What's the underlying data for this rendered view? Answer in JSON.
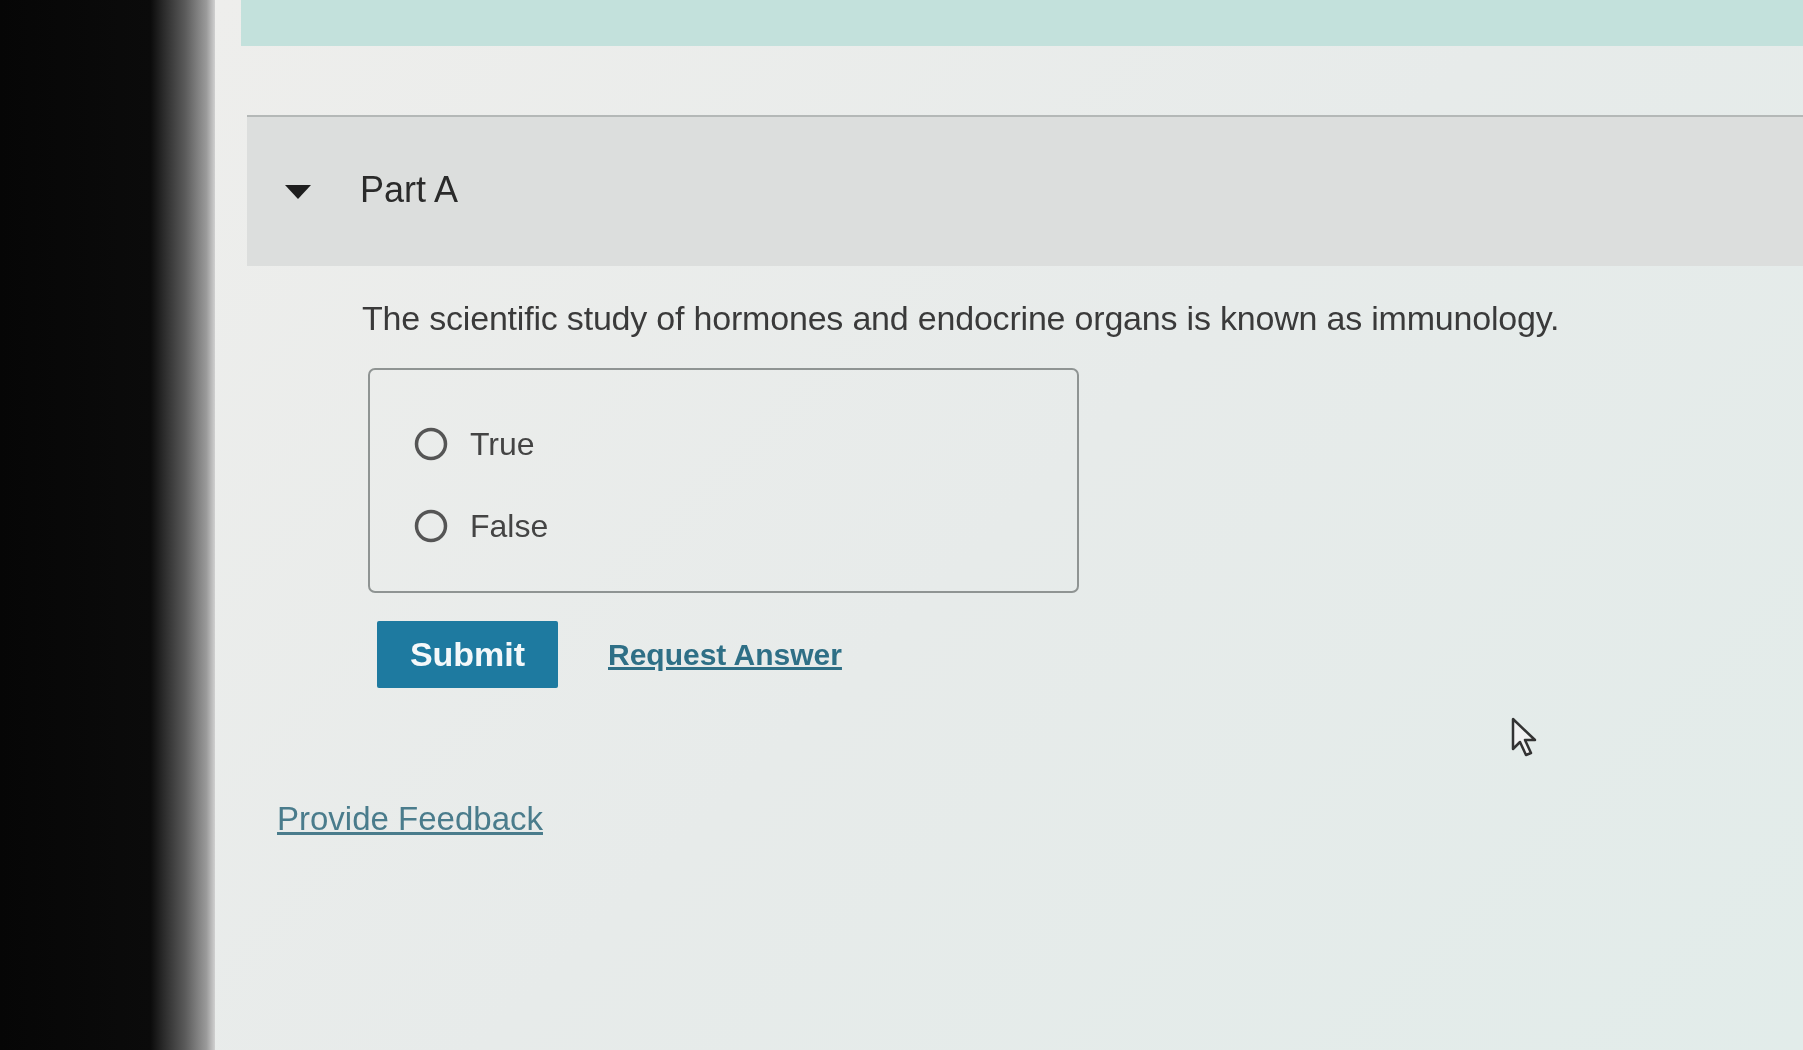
{
  "part": {
    "title": "Part A",
    "expanded": true
  },
  "question": "The scientific study of hormones and endocrine organs is known as immunology.",
  "options": [
    {
      "label": "True",
      "selected": false
    },
    {
      "label": "False",
      "selected": false
    }
  ],
  "submit": "Submit",
  "request_answer": "Request Answer",
  "feedback": "Provide Feedback"
}
